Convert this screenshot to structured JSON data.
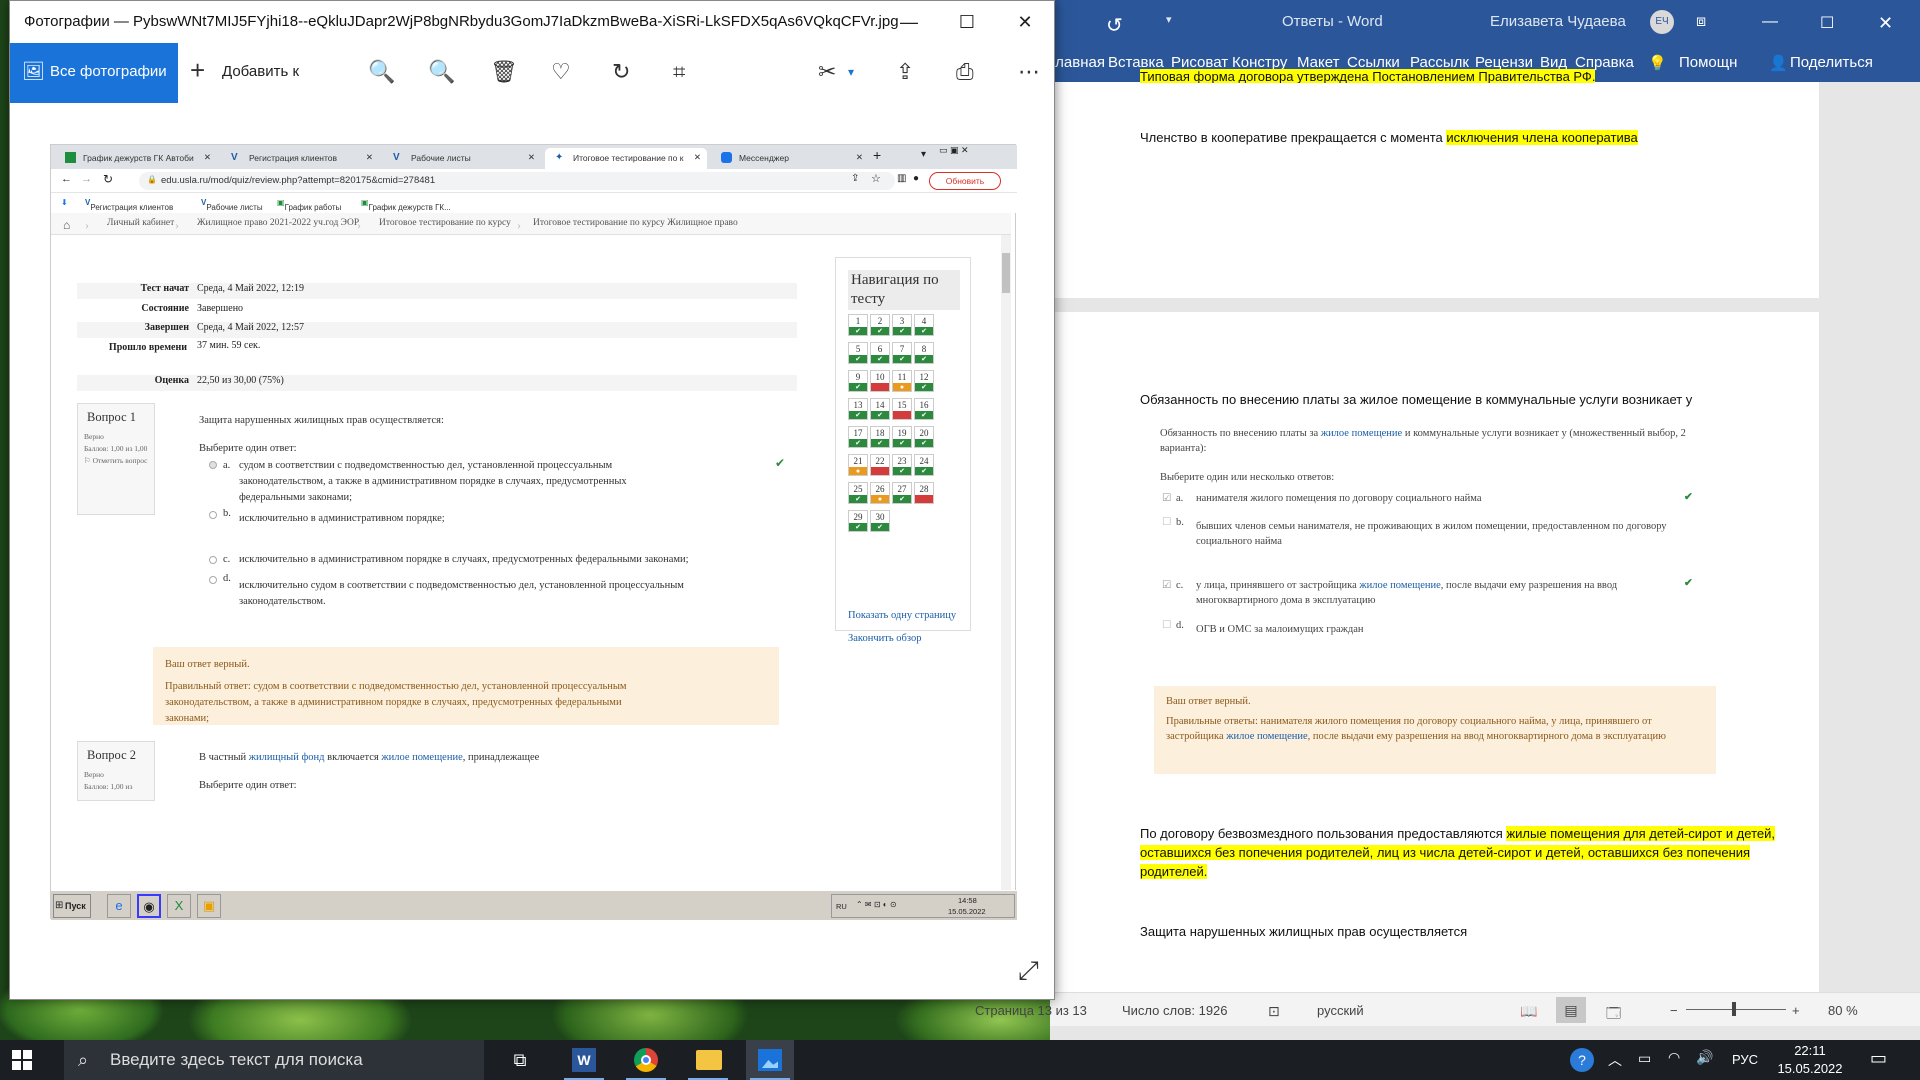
{
  "photos_window": {
    "title": "Фотографии — PybswWNt7MIJ5FYjhi18--eQkluJDapr2WjP8bgNRbydu3GomJ7IaDkzmBweBa-XiSRi-LkSFDX5qAs6VQkqCFVr.jpg",
    "all_photos_label": "Все фотографии",
    "add_to_label": "Добавить к",
    "minimize": "—",
    "maximize": "☐",
    "close": "✕"
  },
  "browser": {
    "tabs": [
      {
        "label": "График дежурств ГК Автоби"
      },
      {
        "label": "Регистрация клиентов"
      },
      {
        "label": "Рабочие листы"
      },
      {
        "label": "Итоговое тестирование по к"
      },
      {
        "label": "Мессенджер"
      }
    ],
    "url": "edu.usla.ru/mod/quiz/review.php?attempt=820175&cmid=278481",
    "update_button": "Обновить",
    "bookmarks": [
      "Регистрация клиентов",
      "Рабочие листы",
      "График работы",
      "График дежурств ГК..."
    ]
  },
  "moodle": {
    "breadcrumb": [
      "Личный кабинет",
      "Жилищное право 2021-2022 уч.год ЭОР",
      "Итоговое тестирование по курсу",
      "Итоговое тестирование по курсу Жилищное право"
    ],
    "summary": [
      {
        "key": "Тест начат",
        "value": "Среда, 4 Май 2022, 12:19"
      },
      {
        "key": "Состояние",
        "value": "Завершено"
      },
      {
        "key": "Завершен",
        "value": "Среда, 4 Май 2022, 12:57"
      },
      {
        "key": "Прошло времени",
        "value": "37 мин. 59 сек."
      },
      {
        "key": "Оценка",
        "value": "22,50 из 30,00 (75%)"
      }
    ],
    "q1": {
      "label": "Вопрос 1",
      "status": "Верно",
      "score": "Баллов: 1,00 из 1,00",
      "flag": "Отметить вопрос",
      "text": "Защита нарушенных жилищных прав осуществляется:",
      "prompt": "Выберите один ответ:",
      "options": [
        {
          "letter": "a.",
          "text": "судом в соответствии  с подведомственностью дел, установленной процессуальным законодательством, а также в административном порядке в случаях, предусмотренных федеральными законами;"
        },
        {
          "letter": "b.",
          "text": "исключительно в административном порядке;"
        },
        {
          "letter": "c.",
          "text": "исключительно в административном порядке в случаях, предусмотренных федеральными законами;"
        },
        {
          "letter": "d.",
          "text": "исключительно судом в соответствии  с подведомственностью дел, установленной процессуальным законодательством."
        }
      ],
      "feedback_title": "Ваш ответ верный.",
      "feedback_body": "Правильный ответ: судом в соответствии  с подведомственностью дел, установленной процессуальным законодательством, а также в административном порядке в случаях, предусмотренных федеральными законами;"
    },
    "q2": {
      "label": "Вопрос 2",
      "status": "Верно",
      "score": "Баллов: 1,00 из",
      "text_before": "В частный ",
      "link1": "жилищный фонд",
      "text_mid": " включается ",
      "link2": "жилое помещение",
      "text_after": ", принадлежащее",
      "prompt": "Выберите один ответ:"
    },
    "nav": {
      "title": "Навигация по тесту",
      "buttons": [
        {
          "n": "1",
          "s": "ok"
        },
        {
          "n": "2",
          "s": "ok"
        },
        {
          "n": "3",
          "s": "ok"
        },
        {
          "n": "4",
          "s": "ok"
        },
        {
          "n": "5",
          "s": "ok"
        },
        {
          "n": "6",
          "s": "ok"
        },
        {
          "n": "7",
          "s": "ok"
        },
        {
          "n": "8",
          "s": "ok"
        },
        {
          "n": "9",
          "s": "ok"
        },
        {
          "n": "10",
          "s": "wrong"
        },
        {
          "n": "11",
          "s": "partial"
        },
        {
          "n": "12",
          "s": "ok"
        },
        {
          "n": "13",
          "s": "ok"
        },
        {
          "n": "14",
          "s": "ok"
        },
        {
          "n": "15",
          "s": "wrong"
        },
        {
          "n": "16",
          "s": "ok"
        },
        {
          "n": "17",
          "s": "ok"
        },
        {
          "n": "18",
          "s": "ok"
        },
        {
          "n": "19",
          "s": "ok"
        },
        {
          "n": "20",
          "s": "ok"
        },
        {
          "n": "21",
          "s": "partial"
        },
        {
          "n": "22",
          "s": "wrong"
        },
        {
          "n": "23",
          "s": "ok"
        },
        {
          "n": "24",
          "s": "ok"
        },
        {
          "n": "25",
          "s": "ok"
        },
        {
          "n": "26",
          "s": "partial"
        },
        {
          "n": "27",
          "s": "ok"
        },
        {
          "n": "28",
          "s": "wrong"
        },
        {
          "n": "29",
          "s": "ok"
        },
        {
          "n": "30",
          "s": "ok"
        }
      ],
      "show_one_page": "Показать одну страницу",
      "finish_review": "Закончить обзор"
    }
  },
  "xp_taskbar": {
    "start_label": "Пуск",
    "lang": "RU",
    "time": "14:58",
    "date": "15.05.2022"
  },
  "word": {
    "title": "Ответы  -  Word",
    "user": "Елизавета Чудаева",
    "user_initials": "ЕЧ",
    "ribbon": [
      "главная",
      "Вставка",
      "Рисоват",
      "Констру",
      "Макет",
      "Ссылки",
      "Рассылк",
      "Рецензи",
      "Вид",
      "Справка",
      "Помощн",
      "Поделиться"
    ],
    "page1_line0": "Типовая форма договора утверждена Постановлением Правительства РФ.",
    "page1_line1_plain": "Членство в кооперативе прекращается с момента ",
    "page1_line1_hl": "исключения члена кооператива",
    "p2_heading": "Обязанность по внесению платы за жилое помещение в коммунальные услуги возникает у",
    "p2_q_before": "Обязанность по внесению платы за ",
    "p2_q_link": "жилое помещение",
    "p2_q_after": " и коммунальные услуги возникает у (множественный выбор, 2 варианта):",
    "p2_prompt": "Выберите один или несколько ответов:",
    "p2_opts": [
      {
        "letter": "a.",
        "text": "нанимателя жилого помещения по договору социального найма"
      },
      {
        "letter": "b.",
        "text": "бывших членов семьи нанимателя, не проживающих в жилом помещении, предоставленном по договору социального найма"
      },
      {
        "letter": "c.",
        "text_before": "у лица, принявшего от застройщика ",
        "link": "жилое помещение",
        "text_after": ", после выдачи ему разрешения на ввод многоквартирного дома в эксплуатацию"
      },
      {
        "letter": "d.",
        "text": "ОГВ и ОМС за малоимущих граждан"
      }
    ],
    "p2_fb_title": "Ваш ответ верный.",
    "p2_fb_before": "Правильные ответы: нанимателя жилого помещения по договору социального найма, у лица, принявшего от застройщика ",
    "p2_fb_link": "жилое помещение",
    "p2_fb_after": ", после выдачи ему разрешения на ввод многоквартирного дома в эксплуатацию",
    "p3_plain": "По договору безвозмездного пользования предоставляются ",
    "p3_hl": "жилые помещения для детей-сирот и детей, оставшихся без попечения родителей, лиц из числа детей-сирот и детей, оставшихся без попечения родителей.",
    "p4": "Защита нарушенных жилищных прав осуществляется",
    "status_page": "Страница 13 из 13",
    "status_words": "Число слов: 1926",
    "status_lang": "русский",
    "zoom": "80 %"
  },
  "taskbar": {
    "search_placeholder": "Введите здесь текст для поиска",
    "lang": "РУС",
    "time": "22:11",
    "date": "15.05.2022"
  }
}
